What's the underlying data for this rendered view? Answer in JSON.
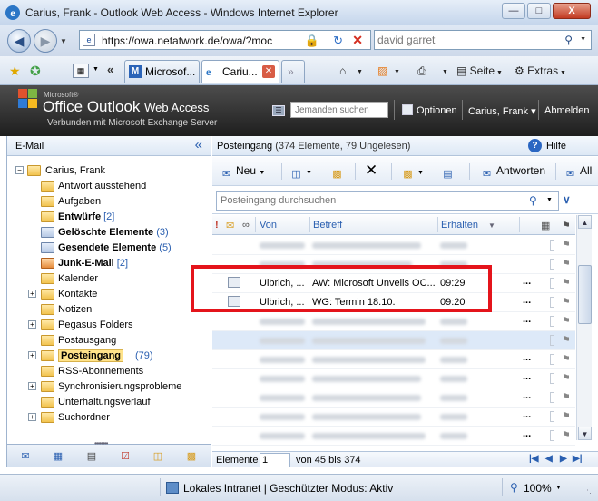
{
  "window": {
    "title": "Carius, Frank - Outlook Web Access - Windows Internet Explorer",
    "buttons": {
      "minimize": "—",
      "maximize": "□",
      "close": "X"
    }
  },
  "address": {
    "url": "https://owa.netatwork.de/owa/?moc",
    "search_value": "david garret"
  },
  "tabs": [
    {
      "label": "Microsof..."
    },
    {
      "label": "Cariu..."
    },
    {
      "label": "»"
    }
  ],
  "commandbar": {
    "home": "⌂",
    "feeds": "▨",
    "print": "⎙",
    "page": "Seite",
    "tools": "Extras"
  },
  "owa": {
    "brand_small": "Microsoft®",
    "brand": "Office Outlook",
    "brand_suffix": "Web Access",
    "connected": "Verbunden mit Microsoft Exchange Server",
    "find_people_placeholder": "Jemanden suchen",
    "options": "Optionen",
    "user": "Carius, Frank",
    "user_caret": "▾",
    "logoff": "Abmelden"
  },
  "navpane": {
    "title": "E-Mail",
    "tree": [
      {
        "label": "Carius, Frank",
        "count": "",
        "bold": false
      },
      {
        "label": "Antwort ausstehend",
        "count": "",
        "bold": false
      },
      {
        "label": "Aufgaben",
        "count": "",
        "bold": false
      },
      {
        "label": "Entwürfe",
        "count": "[2]",
        "bold": true
      },
      {
        "label": "Gelöschte Elemente",
        "count": "(3)",
        "bold": true
      },
      {
        "label": "Gesendete Elemente",
        "count": "(5)",
        "bold": true
      },
      {
        "label": "Junk-E-Mail",
        "count": "[2]",
        "bold": true
      },
      {
        "label": "Kalender",
        "count": "",
        "bold": false
      },
      {
        "label": "Kontakte",
        "count": "",
        "bold": false
      },
      {
        "label": "Notizen",
        "count": "",
        "bold": false
      },
      {
        "label": "Pegasus Folders",
        "count": "",
        "bold": false
      },
      {
        "label": "Postausgang",
        "count": "",
        "bold": false
      },
      {
        "label": "Posteingang",
        "count": "(79)",
        "bold": true
      },
      {
        "label": "RSS-Abonnements",
        "count": "",
        "bold": false
      },
      {
        "label": "Synchronisierungsprobleme",
        "count": "",
        "bold": false
      },
      {
        "label": "Unterhaltungsverlauf",
        "count": "",
        "bold": false
      },
      {
        "label": "Suchordner",
        "count": "",
        "bold": false
      }
    ]
  },
  "main": {
    "folder": "Posteingang",
    "folder_info": "(374 Elemente, 79 Ungelesen)",
    "help": "Hilfe",
    "toolbar": {
      "new": "Neu",
      "reply": "Antworten",
      "reply_all": "All"
    },
    "search_placeholder": "Posteingang durchsuchen",
    "columns": {
      "from": "Von",
      "subject": "Betreff",
      "received": "Erhalten"
    },
    "messages": [
      {
        "from": "Ulbrich, ...",
        "subject": "AW: Microsoft Unveils OC...",
        "received": "09:29",
        "more": "..."
      },
      {
        "from": "Ulbrich, ...",
        "subject": "WG: Termin 18.10.",
        "received": "09:20",
        "more": "..."
      }
    ],
    "hidden_more": "...",
    "pager": {
      "label": "Elemente",
      "value": "1",
      "of": "von 45 bis 374"
    }
  },
  "statusbar": {
    "zone": "Lokales Intranet | Geschützter Modus: Aktiv",
    "zoom": "100%"
  }
}
